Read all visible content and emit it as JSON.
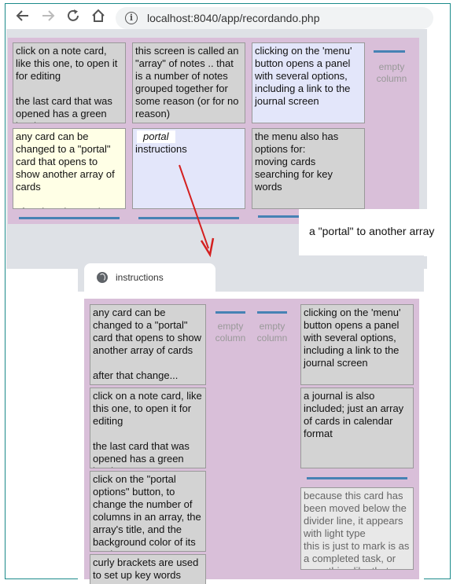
{
  "browser": {
    "back_icon": "arrow-left-icon",
    "forward_icon": "arrow-right-icon",
    "reload_icon": "reload-icon",
    "home_icon": "home-icon",
    "info_icon": "info-icon",
    "info_glyph": "i",
    "url": "localhost:8040/app/recordando.php"
  },
  "board1": {
    "background": "#d9bfd9",
    "cards": [
      {
        "lines": [
          "click on a note card, like this one, to open it for editing",
          "",
          "the last card that was opened has a green border"
        ]
      },
      {
        "lines": [
          "this screen is called an \"array\" of notes .. that is a number of notes grouped together for some reason (or for no reason)"
        ]
      },
      {
        "lines": [
          "clicking on the 'menu' button opens a panel with several options, including a link to the journal screen"
        ]
      },
      {
        "lines": [
          "any card can be changed to a \"portal\" card that opens to show another array of cards",
          "",
          "after that change the card..."
        ]
      },
      {
        "portal_label": "portal",
        "lines": [
          "instructions"
        ]
      },
      {
        "lines": [
          "the menu also has options for:",
          "moving cards",
          "searching for key words"
        ]
      }
    ],
    "empty_column": "empty column"
  },
  "callout": {
    "text": "a \"portal\" to another array"
  },
  "window2": {
    "tab_title": "instructions",
    "globe_icon": "globe-icon"
  },
  "board2": {
    "cards": [
      {
        "lines": [
          "any card can be changed to a \"portal\" card that opens to show another array of cards",
          "",
          "after that change..."
        ]
      },
      {
        "lines": [
          "click on a note card, like this one, to open it for editing",
          "",
          "the last card that was opened has a green border"
        ]
      },
      {
        "lines": [
          "click on the \"portal options\" button, to change the number of columns in an array, the array's title, and the background color of its cards"
        ]
      },
      {
        "lines": [
          "curly brackets are used to set up key words"
        ]
      },
      {
        "lines": [
          "clicking on the 'menu' button opens a panel with several options, including a link to the journal screen"
        ]
      },
      {
        "lines": [
          "a journal is also included; just an array of cards in calendar format"
        ]
      },
      {
        "lines": [
          "because this card has been moved below the divider line, it appears with light type",
          "this is just to mark is as a completed task, or something like that"
        ]
      }
    ],
    "empty_column_1": "empty column",
    "empty_column_2": "empty column"
  },
  "colors": {
    "board": "#d9bfd9",
    "card_gray": "#d3d3d3",
    "card_yellow": "#ffffe6",
    "card_blue": "#e3e6fa",
    "divider": "#4682b4",
    "arrow": "#d42020"
  }
}
